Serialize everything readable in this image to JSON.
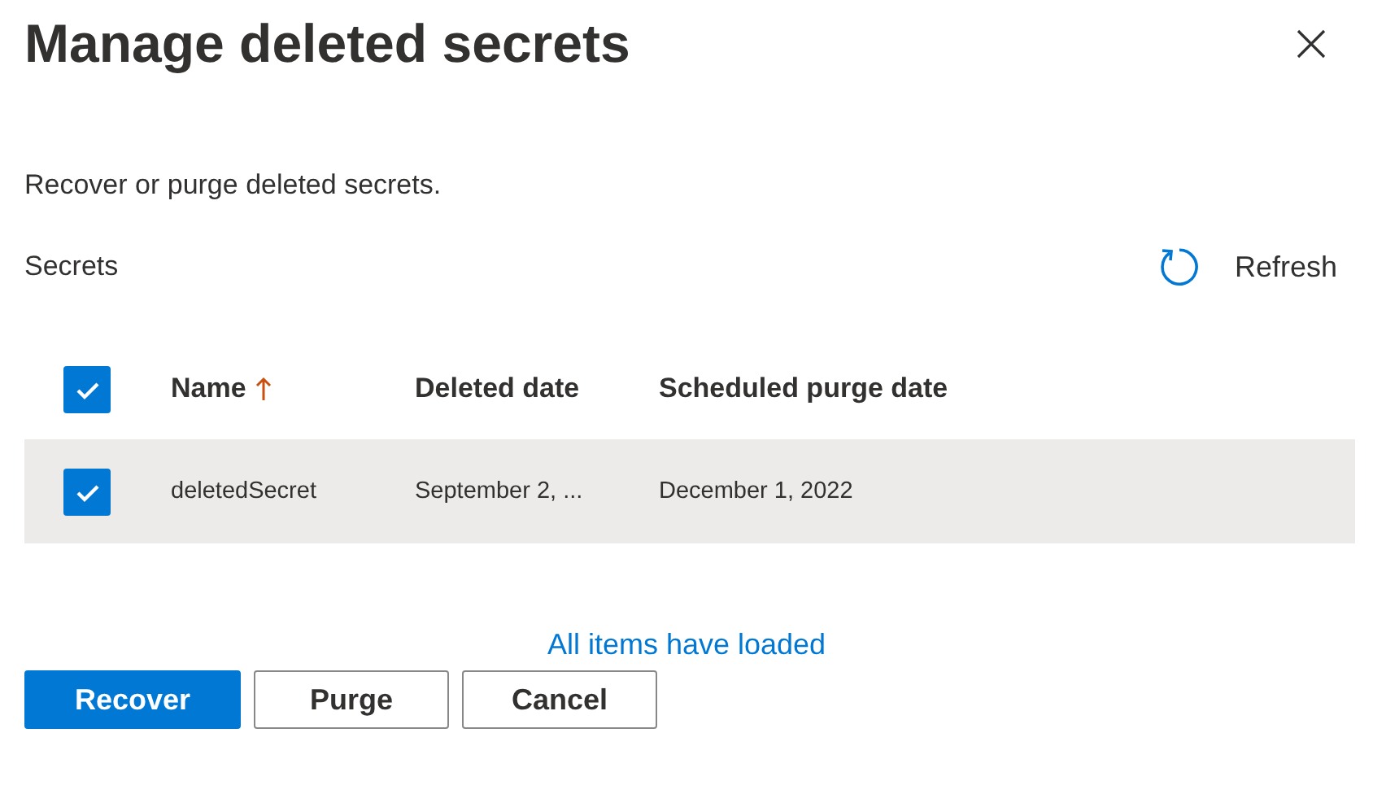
{
  "dialog": {
    "title": "Manage deleted secrets",
    "description": "Recover or purge deleted secrets."
  },
  "toolbar": {
    "label": "Secrets",
    "refresh": "Refresh"
  },
  "table": {
    "select_all": {
      "checked": true
    },
    "columns": [
      {
        "label": "Name",
        "sorted": true
      },
      {
        "label": "Deleted date",
        "sorted": false
      },
      {
        "label": "Scheduled purge date",
        "sorted": false
      }
    ],
    "rows": [
      {
        "selected": true,
        "cells": [
          "deletedSecret",
          "September 2, ...",
          "December 1, 2022"
        ]
      }
    ]
  },
  "status": "All items have loaded",
  "buttons": [
    {
      "label": "Recover",
      "kind": "primary"
    },
    {
      "label": "Purge",
      "kind": "default"
    },
    {
      "label": "Cancel",
      "kind": "default"
    }
  ]
}
